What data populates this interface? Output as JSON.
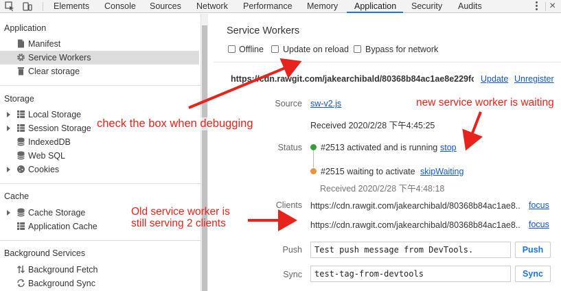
{
  "tabbar": {
    "tabs": [
      "Elements",
      "Console",
      "Sources",
      "Network",
      "Performance",
      "Memory",
      "Application",
      "Security",
      "Audits"
    ],
    "active_tab": "Application",
    "close_glyph": "×"
  },
  "sidebar": {
    "application": {
      "title": "Application",
      "items": [
        "Manifest",
        "Service Workers",
        "Clear storage"
      ]
    },
    "storage": {
      "title": "Storage",
      "items": [
        "Local Storage",
        "Session Storage",
        "IndexedDB",
        "Web SQL",
        "Cookies"
      ]
    },
    "cache": {
      "title": "Cache",
      "items": [
        "Cache Storage",
        "Application Cache"
      ]
    },
    "background": {
      "title": "Background Services",
      "items": [
        "Background Fetch",
        "Background Sync"
      ]
    },
    "selected": "Service Workers"
  },
  "main": {
    "title": "Service Workers",
    "options": {
      "offline": "Offline",
      "update_on_reload": "Update on reload",
      "bypass": "Bypass for network"
    },
    "sw_url": "https://cdn.rawgit.com/jakearchibald/80368b84ac1ae8e229fc9...",
    "update_link": "Update",
    "unregister_link": "Unregister",
    "source_label": "Source",
    "source_link": "sw-v2.js",
    "received": "Received 2020/2/28 下午4:45:25",
    "status_label": "Status",
    "status_active": "#2513 activated and is running",
    "stop_link": "stop",
    "status_waiting": "#2515 waiting to activate",
    "skip_link": "skipWaiting",
    "waiting_received": "Received 2020/2/28 下午4:48:18",
    "clients_label": "Clients",
    "clients": [
      {
        "url": "https://cdn.rawgit.com/jakearchibald/80368b84ac1ae8...",
        "action": "focus"
      },
      {
        "url": "https://cdn.rawgit.com/jakearchibald/80368b84ac1ae8...",
        "action": "focus"
      }
    ],
    "push_label": "Push",
    "push_value": "Test push message from DevTools.",
    "push_button": "Push",
    "sync_label": "Sync",
    "sync_value": "test-tag-from-devtools",
    "sync_button": "Sync",
    "status_colors": {
      "active": "#3c9a3c",
      "waiting": "#e8943a"
    }
  },
  "annotations": {
    "check_box": "check the box when debugging",
    "new_worker": "new service worker is waiting",
    "old_worker_line1": "Old service worker is",
    "old_worker_line2": "still serving 2 clients",
    "color": "#e8231b"
  }
}
